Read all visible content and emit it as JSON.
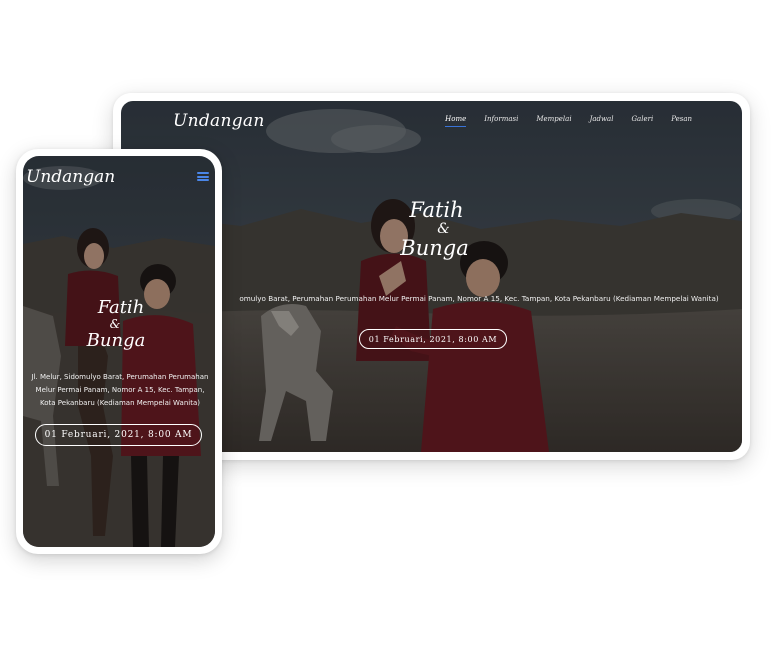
{
  "desktop": {
    "brand": "Undangan",
    "nav": [
      "Home",
      "Informasi",
      "Mempelai",
      "Jadwal",
      "Galeri",
      "Pesan"
    ],
    "active_nav": "Home",
    "name_groom": "Fatih",
    "ampersand": "&",
    "name_bride": "Bunga",
    "address": "omulyo Barat, Perumahan Perumahan Melur Permai Panam, Nomor A 15, Kec. Tampan, Kota Pekanbaru (Kediaman Mempelai Wanita)",
    "date_button": "01 Februari, 2021, 8:00 AM"
  },
  "mobile": {
    "brand": "Undangan",
    "menu_icon": "hamburger-menu-icon",
    "name_groom": "Fatih",
    "ampersand": "&",
    "name_bride": "Bunga",
    "address": "Jl. Melur, Sidomulyo Barat, Perumahan Perumahan Melur Permai Panam, Nomor A 15, Kec. Tampan, Kota Pekanbaru (Kediaman Mempelai Wanita)",
    "date_button": "01 Februari, 2021, 8:00 AM"
  },
  "colors": {
    "accent": "#3a73d8",
    "overlay": "#000000",
    "sweater": "#6d1d24"
  }
}
